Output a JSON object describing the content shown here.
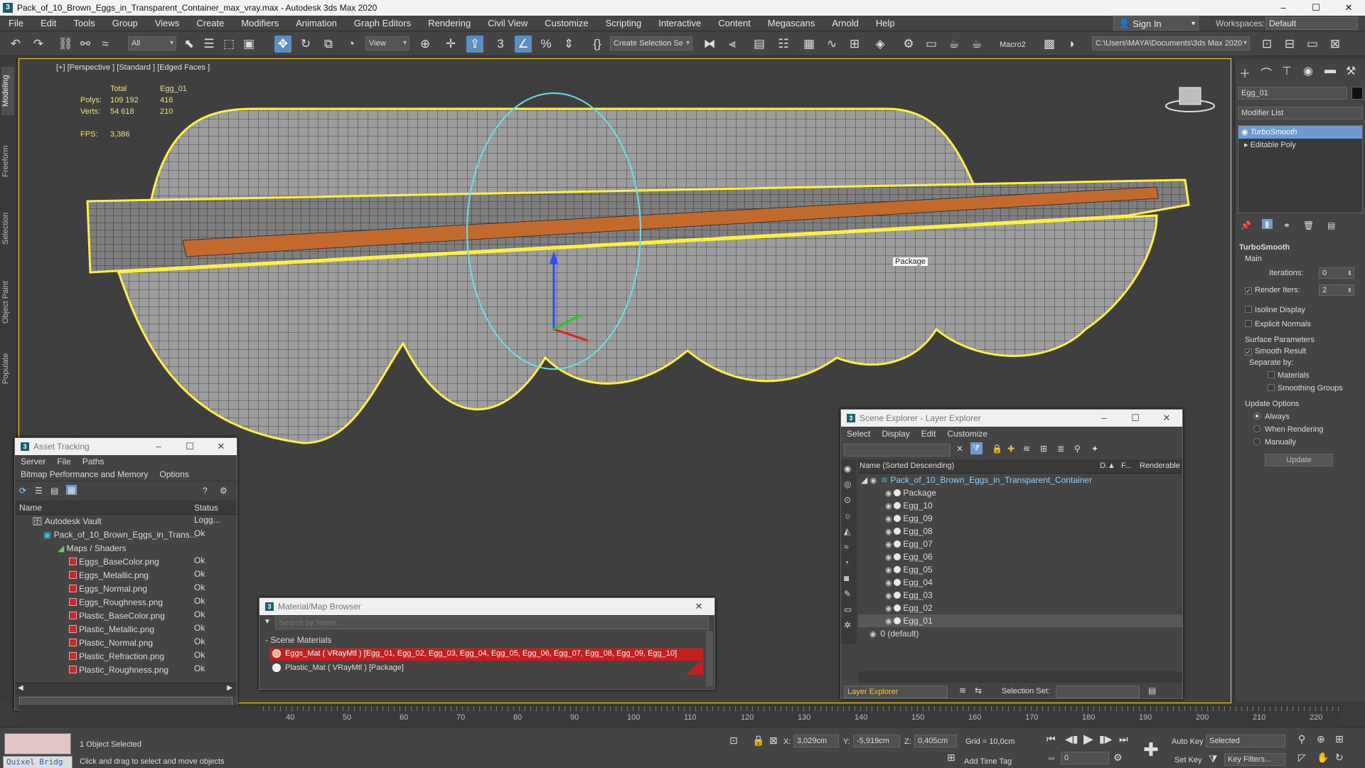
{
  "window": {
    "title": "Pack_of_10_Brown_Eggs_in_Transparent_Container_max_vray.max - Autodesk 3ds Max 2020",
    "controls": [
      "–",
      "☐",
      "✕"
    ]
  },
  "menubar": {
    "items": [
      "File",
      "Edit",
      "Tools",
      "Group",
      "Views",
      "Create",
      "Modifiers",
      "Animation",
      "Graph Editors",
      "Rendering",
      "Civil View",
      "Customize",
      "Scripting",
      "Interactive",
      "Content",
      "Megascans",
      "Arnold",
      "Help"
    ],
    "sign_in": "Sign In",
    "workspaces_label": "Workspaces:",
    "workspace_value": "Default"
  },
  "toolbar": {
    "selection_filter": "All",
    "ref_coord": "View",
    "named_selection": "Create Selection Se",
    "macro": "Macro2",
    "project_path": "C:\\Users\\MAYA\\Documents\\3ds Max 2020"
  },
  "left_tabs": [
    "Modeling",
    "Freeform",
    "Selection",
    "Object Paint",
    "Populate"
  ],
  "viewport": {
    "label": "[+] [Perspective ] [Standard ] [Edged Faces ]",
    "stats": {
      "col_total": "Total",
      "col_object": "Egg_01",
      "polys_label": "Polys:",
      "polys_total": "109 192",
      "polys_obj": "416",
      "verts_label": "Verts:",
      "verts_total": "54 618",
      "verts_obj": "210",
      "fps_label": "FPS:",
      "fps_value": "3,386"
    },
    "tooltip": "Package"
  },
  "asset_tracking": {
    "title": "Asset Tracking",
    "menu1": [
      "Server",
      "File",
      "Paths"
    ],
    "menu2": [
      "Bitmap Performance and Memory",
      "Options"
    ],
    "headers": [
      "Name",
      "Status"
    ],
    "vault": {
      "name": "Autodesk Vault",
      "status": "Logg..."
    },
    "scene": {
      "name": "Pack_of_10_Brown_Eggs_in_Trans...",
      "status": "Ok"
    },
    "maps_folder": "Maps / Shaders",
    "files": [
      {
        "name": "Eggs_BaseColor.png",
        "status": "Ok"
      },
      {
        "name": "Eggs_Metallic.png",
        "status": "Ok"
      },
      {
        "name": "Eggs_Normal.png",
        "status": "Ok"
      },
      {
        "name": "Eggs_Roughness.png",
        "status": "Ok"
      },
      {
        "name": "Plastic_BaseColor.png",
        "status": "Ok"
      },
      {
        "name": "Plastic_Metallic.png",
        "status": "Ok"
      },
      {
        "name": "Plastic_Normal.png",
        "status": "Ok"
      },
      {
        "name": "Plastic_Refraction.png",
        "status": "Ok"
      },
      {
        "name": "Plastic_Roughness.png",
        "status": "Ok"
      }
    ]
  },
  "material_browser": {
    "title": "Material/Map Browser",
    "search_placeholder": "Search by Name ...",
    "section": "- Scene Materials",
    "materials": [
      {
        "label": "Eggs_Mat  ( VRayMtl ) [Egg_01, Egg_02, Egg_03, Egg_04, Egg_05, Egg_06, Egg_07, Egg_08, Egg_09, Egg_10]",
        "selected": true
      },
      {
        "label": "Plastic_Mat  ( VRayMtl ) [Package]",
        "selected": false
      }
    ]
  },
  "scene_explorer": {
    "title": "Scene Explorer - Layer Explorer",
    "menu": [
      "Select",
      "Display",
      "Edit",
      "Customize"
    ],
    "headers": {
      "name": "Name (Sorted Descending)",
      "d": "D.▲",
      "f": "F...",
      "renderable": "Renderable"
    },
    "root": "Pack_of_10_Brown_Eggs_in_Transparent_Container",
    "children": [
      "Package",
      "Egg_10",
      "Egg_09",
      "Egg_08",
      "Egg_07",
      "Egg_06",
      "Egg_05",
      "Egg_04",
      "Egg_03",
      "Egg_02",
      "Egg_01"
    ],
    "default_layer": "0 (default)",
    "footer_dropdown": "Layer Explorer",
    "selection_set_label": "Selection Set:"
  },
  "command_panel": {
    "object_name": "Egg_01",
    "modifier_list": "Modifier List",
    "stack": [
      "TurboSmooth",
      "Editable Poly"
    ],
    "rollout_title": "TurboSmooth",
    "main_label": "Main",
    "iterations_label": "Iterations:",
    "iterations_value": "0",
    "render_iters_label": "Render Iters:",
    "render_iters_value": "2",
    "isoline": "Isoline Display",
    "explicit_normals": "Explicit Normals",
    "surface_params": "Surface Parameters",
    "smooth_result": "Smooth Result",
    "separate_by": "Separate by:",
    "materials": "Materials",
    "smoothing_groups": "Smoothing Groups",
    "update_options": "Update Options",
    "always": "Always",
    "when_rendering": "When Rendering",
    "manually": "Manually",
    "update_button": "Update"
  },
  "timeline": {
    "ticks": [
      "40",
      "50",
      "60",
      "70",
      "80",
      "90",
      "100",
      "110",
      "120",
      "130",
      "140",
      "150",
      "160",
      "170",
      "180",
      "190",
      "200",
      "210",
      "220"
    ]
  },
  "statusbar": {
    "objects_selected": "1 Object Selected",
    "prompt": "Click and drag to select and move objects",
    "quixel": "Quixel Bridg",
    "x_label": "X:",
    "x_value": "3,029cm",
    "y_label": "Y:",
    "y_value": "-5,919cm",
    "z_label": "Z:",
    "z_value": "0,405cm",
    "grid": "Grid = 10,0cm",
    "add_time_tag": "Add Time Tag",
    "auto_key": "Auto Key",
    "set_key": "Set Key",
    "key_mode": "Selected",
    "key_filters": "Key Filters...",
    "frame": "0"
  }
}
